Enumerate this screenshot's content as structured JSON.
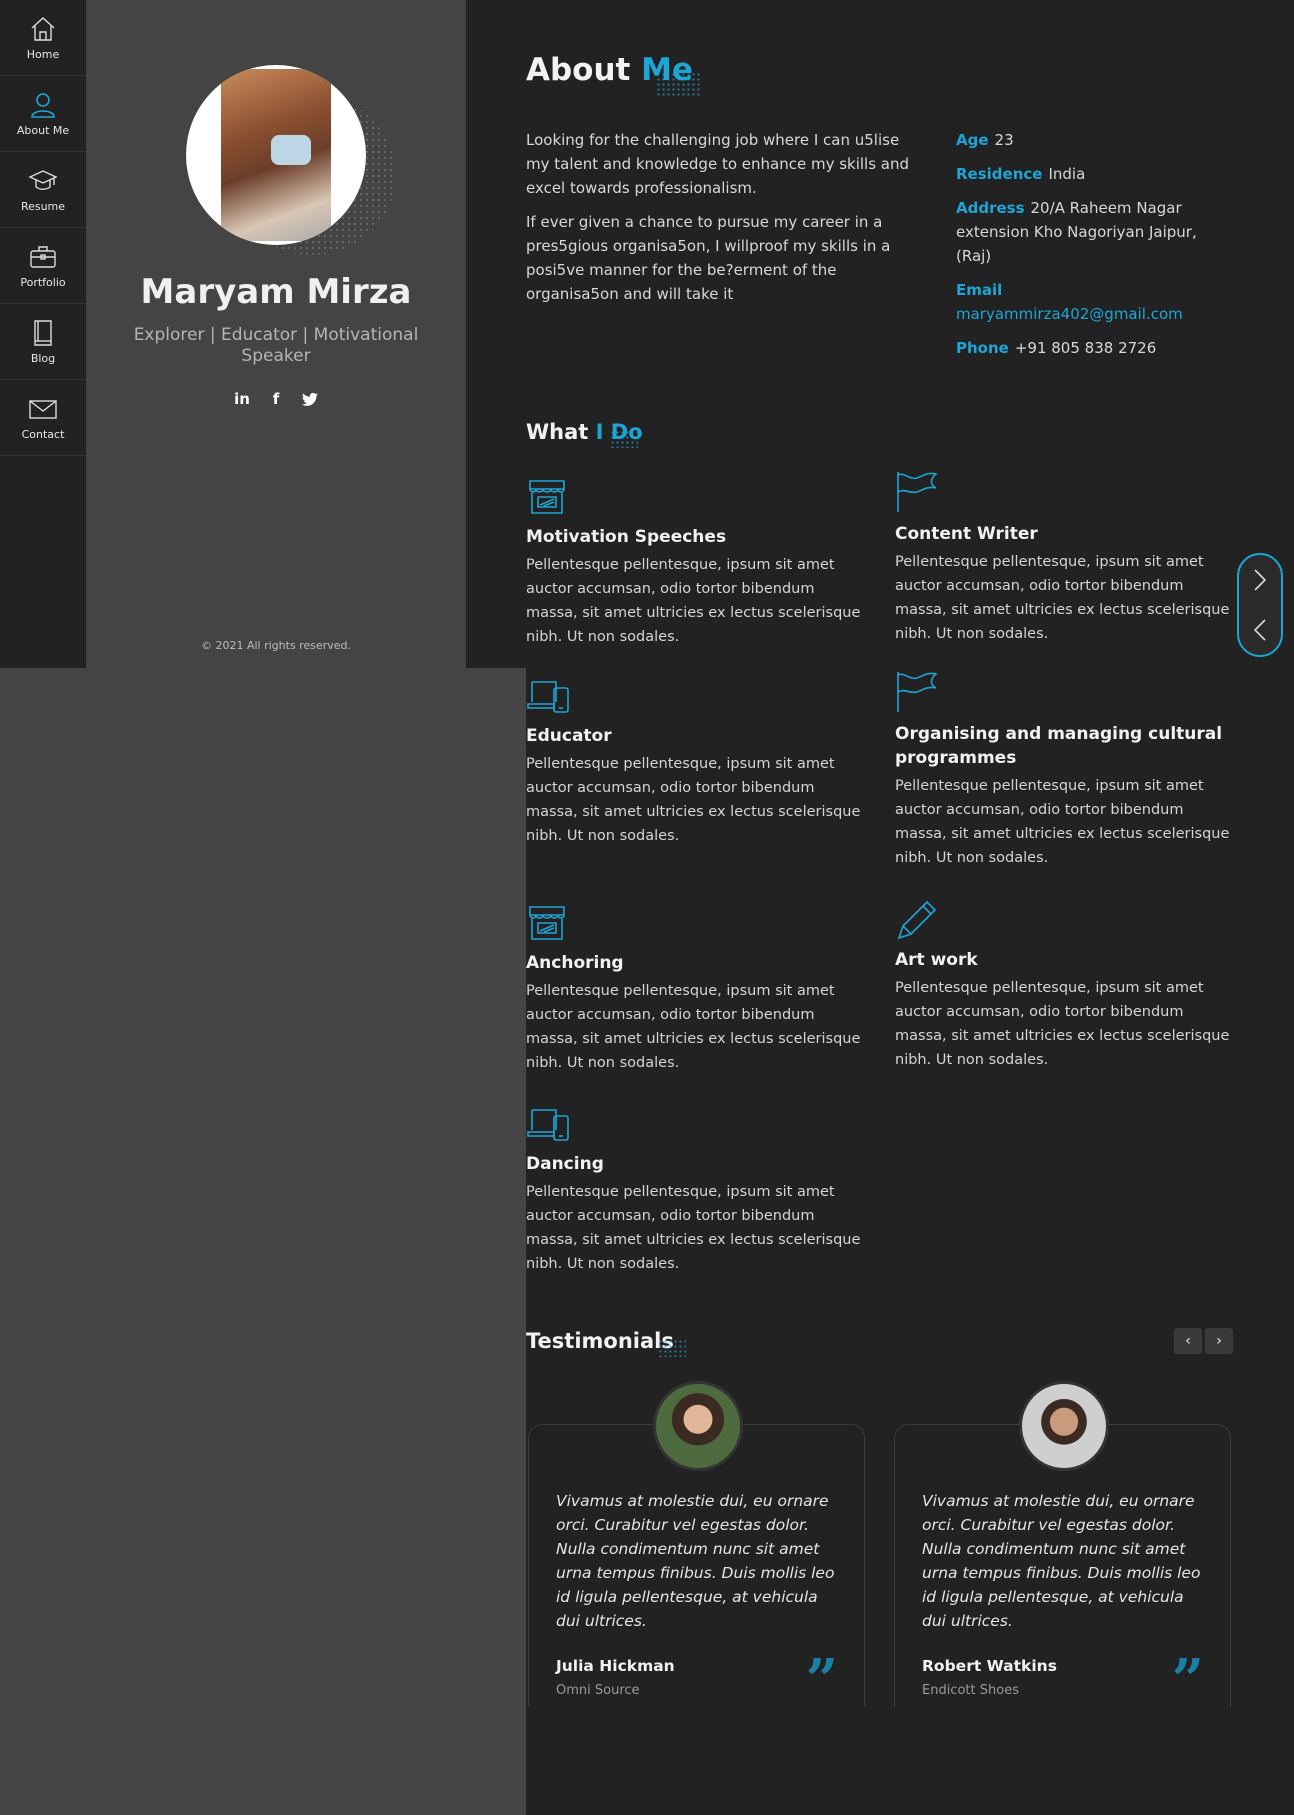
{
  "nav": {
    "items": [
      {
        "label": "Home",
        "icon": "home-icon"
      },
      {
        "label": "About Me",
        "icon": "user-icon"
      },
      {
        "label": "Resume",
        "icon": "graduation-cap-icon"
      },
      {
        "label": "Portfolio",
        "icon": "briefcase-icon"
      },
      {
        "label": "Blog",
        "icon": "book-icon"
      },
      {
        "label": "Contact",
        "icon": "envelope-icon"
      }
    ]
  },
  "profile": {
    "name": "Maryam Mirza",
    "tagline": "Explorer | Educator | Motivational Speaker",
    "socials": [
      {
        "label": "in",
        "icon": "linkedin-icon"
      },
      {
        "label": "f",
        "icon": "facebook-icon"
      },
      {
        "label": "t",
        "icon": "twitter-icon"
      }
    ],
    "copyright": "© 2021 All rights reserved."
  },
  "about": {
    "title_plain": "About",
    "title_accent": "Me",
    "paragraphs": [
      "Looking for the challenging job where I can u5lise my talent and knowledge to enhance my skills and excel towards professionalism.",
      "If ever given a chance to pursue my career in a pres5gious organisa5on, I willproof my skills in a posi5ve manner for the be?erment of the organisa5on and will take it"
    ],
    "info": {
      "age_label": "Age",
      "age": "23",
      "residence_label": "Residence",
      "residence": "India",
      "address_label": "Address",
      "address": "20/A Raheem Nagar extension Kho Nagoriyan Jaipur,(Raj)",
      "email_label": "Email",
      "email": "maryammirza402@gmail.com",
      "phone_label": "Phone",
      "phone": "+91 805 838 2726"
    }
  },
  "what_i_do": {
    "title_plain": "What",
    "title_accent": "I Do",
    "services": [
      {
        "title": "Motivation Speeches",
        "text": "Pellentesque pellentesque, ipsum sit amet auctor accumsan, odio tortor bibendum massa, sit amet ultricies ex lectus scelerisque nibh. Ut non sodales.",
        "icon": "store-icon"
      },
      {
        "title": "Content Writer",
        "text": "Pellentesque pellentesque, ipsum sit amet auctor accumsan, odio tortor bibendum massa, sit amet ultricies ex lectus scelerisque nibh. Ut non sodales.",
        "icon": "flag-icon"
      },
      {
        "title": "Educator",
        "text": "Pellentesque pellentesque, ipsum sit amet auctor accumsan, odio tortor bibendum massa, sit amet ultricies ex lectus scelerisque nibh. Ut non sodales.",
        "icon": "devices-icon"
      },
      {
        "title": "Organising and managing cultural programmes",
        "text": "Pellentesque pellentesque, ipsum sit amet auctor accumsan, odio tortor bibendum massa, sit amet ultricies ex lectus scelerisque nibh. Ut non sodales.",
        "icon": "flag-icon"
      },
      {
        "title": "Anchoring",
        "text": "Pellentesque pellentesque, ipsum sit amet auctor accumsan, odio tortor bibendum massa, sit amet ultricies ex lectus scelerisque nibh. Ut non sodales.",
        "icon": "store-icon"
      },
      {
        "title": "Art work",
        "text": "Pellentesque pellentesque, ipsum sit amet auctor accumsan, odio tortor bibendum massa, sit amet ultricies ex lectus scelerisque nibh. Ut non sodales.",
        "icon": "pencil-icon"
      },
      {
        "title": "Dancing",
        "text": "Pellentesque pellentesque, ipsum sit amet auctor accumsan, odio tortor bibendum massa, sit amet ultricies ex lectus scelerisque nibh. Ut non sodales.",
        "icon": "devices-icon"
      }
    ]
  },
  "testimonials": {
    "title": "Testimonials",
    "prev": "‹",
    "next": "›",
    "items": [
      {
        "quote": "Vivamus at molestie dui, eu ornare orci. Curabitur vel egestas dolor. Nulla condimentum nunc sit amet urna tempus finibus. Duis mollis leo id ligula pellentesque, at vehicula dui ultrices.",
        "name": "Julia Hickman",
        "company": "Omni Source"
      },
      {
        "quote": "Vivamus at molestie dui, eu ornare orci. Curabitur vel egestas dolor. Nulla condimentum nunc sit amet urna tempus finibus. Duis mollis leo id ligula pellentesque, at vehicula dui ultrices.",
        "name": "Robert Watkins",
        "company": "Endicott Shoes"
      }
    ]
  },
  "colors": {
    "accent": "#1ea5d6",
    "sidebar": "#222222",
    "panel": "#444444",
    "main": "#222222"
  }
}
